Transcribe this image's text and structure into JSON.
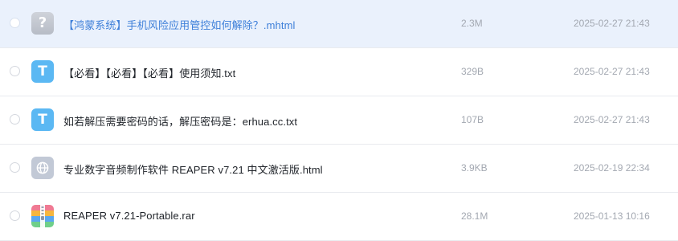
{
  "files": [
    {
      "name": "【鸿蒙系统】手机风险应用管控如何解除？.mhtml",
      "size": "2.3M",
      "date": "2025-02-27 21:43",
      "icon": "unknown-file-icon",
      "icon_glyph": "?",
      "hovered": true
    },
    {
      "name": "【必看】【必看】【必看】使用须知.txt",
      "size": "329B",
      "date": "2025-02-27 21:43",
      "icon": "txt-file-icon",
      "icon_glyph": "T"
    },
    {
      "name": "如若解压需要密码的话，解压密码是：erhua.cc.txt",
      "size": "107B",
      "date": "2025-02-27 21:43",
      "icon": "txt-file-icon",
      "icon_glyph": "T"
    },
    {
      "name": "专业数字音频制作软件 REAPER v7.21 中文激活版.html",
      "size": "3.9KB",
      "date": "2025-02-19 22:34",
      "icon": "web-file-icon"
    },
    {
      "name": "REAPER v7.21-Portable.rar",
      "size": "28.1M",
      "date": "2025-01-13 10:16",
      "icon": "rar-archive-icon"
    }
  ],
  "colors": {
    "hover_row_bg": "#eaf1fc",
    "hover_name": "#3d7fd9",
    "txt_icon": "#5bb8f3",
    "meta_text": "#a3a8b1"
  }
}
